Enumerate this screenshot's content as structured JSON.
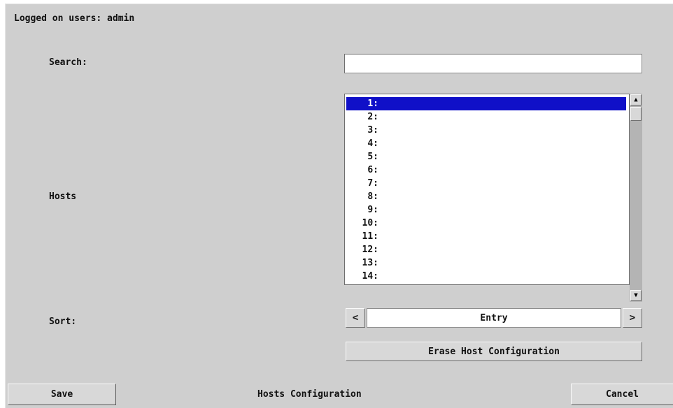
{
  "header": {
    "logged_on": "Logged on users: admin"
  },
  "search": {
    "label": "Search:",
    "value": ""
  },
  "hosts": {
    "label": "Hosts",
    "items": [
      {
        "num": "1:",
        "selected": true
      },
      {
        "num": "2:",
        "selected": false
      },
      {
        "num": "3:",
        "selected": false
      },
      {
        "num": "4:",
        "selected": false
      },
      {
        "num": "5:",
        "selected": false
      },
      {
        "num": "6:",
        "selected": false
      },
      {
        "num": "7:",
        "selected": false
      },
      {
        "num": "8:",
        "selected": false
      },
      {
        "num": "9:",
        "selected": false
      },
      {
        "num": "10:",
        "selected": false
      },
      {
        "num": "11:",
        "selected": false
      },
      {
        "num": "12:",
        "selected": false
      },
      {
        "num": "13:",
        "selected": false
      },
      {
        "num": "14:",
        "selected": false
      }
    ]
  },
  "sort": {
    "label": "Sort:",
    "value": "Entry",
    "prev": "<",
    "next": ">"
  },
  "actions": {
    "erase_label": "Erase Host Configuration",
    "save_label": "Save",
    "cancel_label": "Cancel"
  },
  "footer": {
    "title": "Hosts Configuration"
  },
  "colors": {
    "background": "#cfcfcf",
    "selection": "#1010c8",
    "field": "#ffffff"
  }
}
